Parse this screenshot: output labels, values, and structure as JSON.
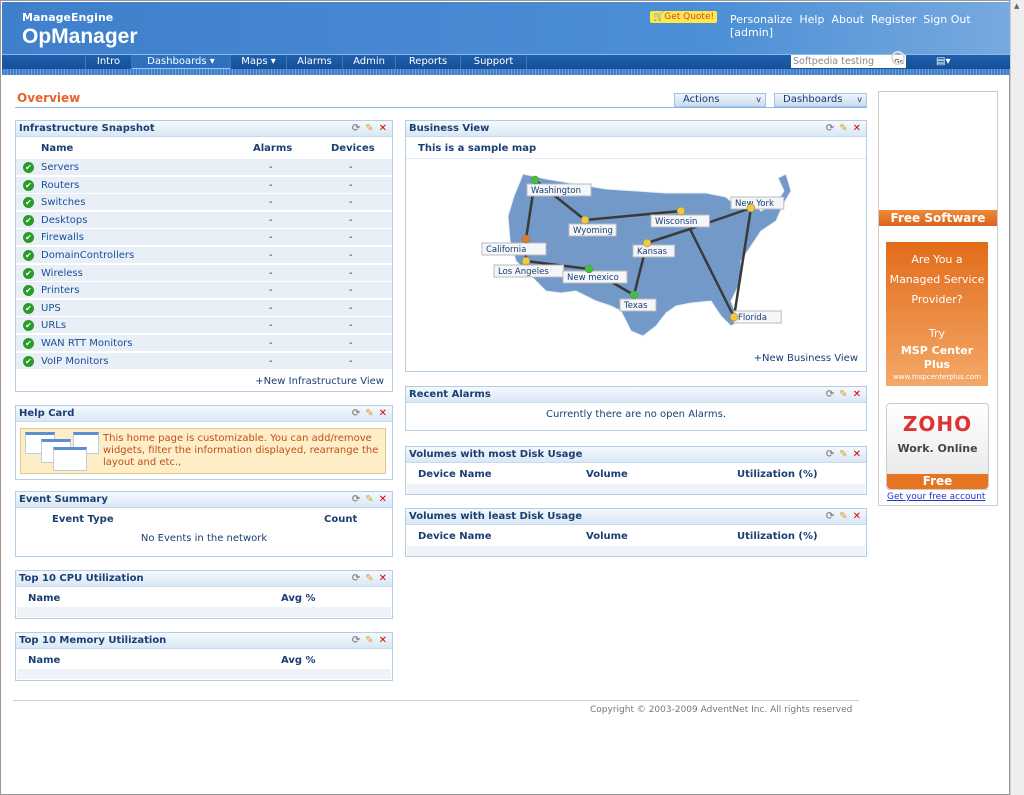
{
  "header": {
    "brand": "ManageEngine",
    "product": "OpManager",
    "get_quote": "Get Quote!",
    "links": [
      "Personalize",
      "Help",
      "About",
      "Register",
      "Sign Out [admin]"
    ]
  },
  "nav": {
    "items": [
      "Intro",
      "Dashboards ▾",
      "Maps ▾",
      "Alarms",
      "Admin",
      "Reports",
      "Support"
    ],
    "active": "Dashboards",
    "search_value": "Softpedia testing",
    "go": "Go"
  },
  "page": {
    "title": "Overview",
    "actions": "Actions",
    "dashboards": "Dashboards"
  },
  "infra": {
    "title": "Infrastructure Snapshot",
    "cols": [
      "Name",
      "Alarms",
      "Devices"
    ],
    "rows": [
      [
        "Servers",
        "-",
        "-"
      ],
      [
        "Routers",
        "-",
        "-"
      ],
      [
        "Switches",
        "-",
        "-"
      ],
      [
        "Desktops",
        "-",
        "-"
      ],
      [
        "Firewalls",
        "-",
        "-"
      ],
      [
        "DomainControllers",
        "-",
        "-"
      ],
      [
        "Wireless",
        "-",
        "-"
      ],
      [
        "Printers",
        "-",
        "-"
      ],
      [
        "UPS",
        "-",
        "-"
      ],
      [
        "URLs",
        "-",
        "-"
      ],
      [
        "WAN RTT Monitors",
        "-",
        "-"
      ],
      [
        "VoIP Monitors",
        "-",
        "-"
      ]
    ],
    "new_link": "+New Infrastructure View"
  },
  "help": {
    "title": "Help Card",
    "text": "This home page is customizable. You can add/remove widgets, filter the information displayed, rearrange the layout and etc.,"
  },
  "events": {
    "title": "Event Summary",
    "cols": [
      "Event Type",
      "Count"
    ],
    "empty": "No Events in the network"
  },
  "cpu": {
    "title": "Top 10 CPU Utilization",
    "cols": [
      "Name",
      "Avg %"
    ]
  },
  "mem": {
    "title": "Top 10 Memory Utilization",
    "cols": [
      "Name",
      "Avg %"
    ]
  },
  "business": {
    "title": "Business View",
    "subtitle": "This is a sample map",
    "new_link": "+New Business View",
    "cities": [
      {
        "name": "Washington",
        "status": "green"
      },
      {
        "name": "California",
        "status": "orange"
      },
      {
        "name": "Los Angeles",
        "status": "yellow"
      },
      {
        "name": "Wyoming",
        "status": "yellow"
      },
      {
        "name": "New mexico",
        "status": "green"
      },
      {
        "name": "Texas",
        "status": "green"
      },
      {
        "name": "Kansas",
        "status": "yellow"
      },
      {
        "name": "Wisconsin",
        "status": "yellow"
      },
      {
        "name": "New York",
        "status": "yellow"
      },
      {
        "name": "Florida",
        "status": "yellow"
      }
    ]
  },
  "alarms": {
    "title": "Recent Alarms",
    "empty": "Currently there are no open Alarms."
  },
  "vol_most": {
    "title": "Volumes with most Disk Usage",
    "cols": [
      "Device Name",
      "Volume",
      "Utilization (%)"
    ]
  },
  "vol_least": {
    "title": "Volumes with least Disk Usage",
    "cols": [
      "Device Name",
      "Volume",
      "Utilization (%)"
    ]
  },
  "ad": {
    "free_software": "Free Software",
    "msp_lines": [
      "Are You a",
      "Managed Service",
      "Provider?",
      "",
      "Try"
    ],
    "msp_product": "MSP Center Plus",
    "msp_url": "www.mspcenterplus.com",
    "zoho": "ZOHO",
    "zoho_tag": "Work. Online",
    "zoho_free": "Free",
    "zoho_link": "Get your free account"
  },
  "footer": {
    "copyright": "Copyright © 2003-2009 AdventNet Inc. All rights reserved"
  },
  "colors": {
    "header": "#4b8fd6",
    "nav": "#1d5fae",
    "accent": "#e8632a",
    "green": "#3cc23c",
    "yellow": "#f2c93a",
    "orange": "#e07a2a"
  }
}
